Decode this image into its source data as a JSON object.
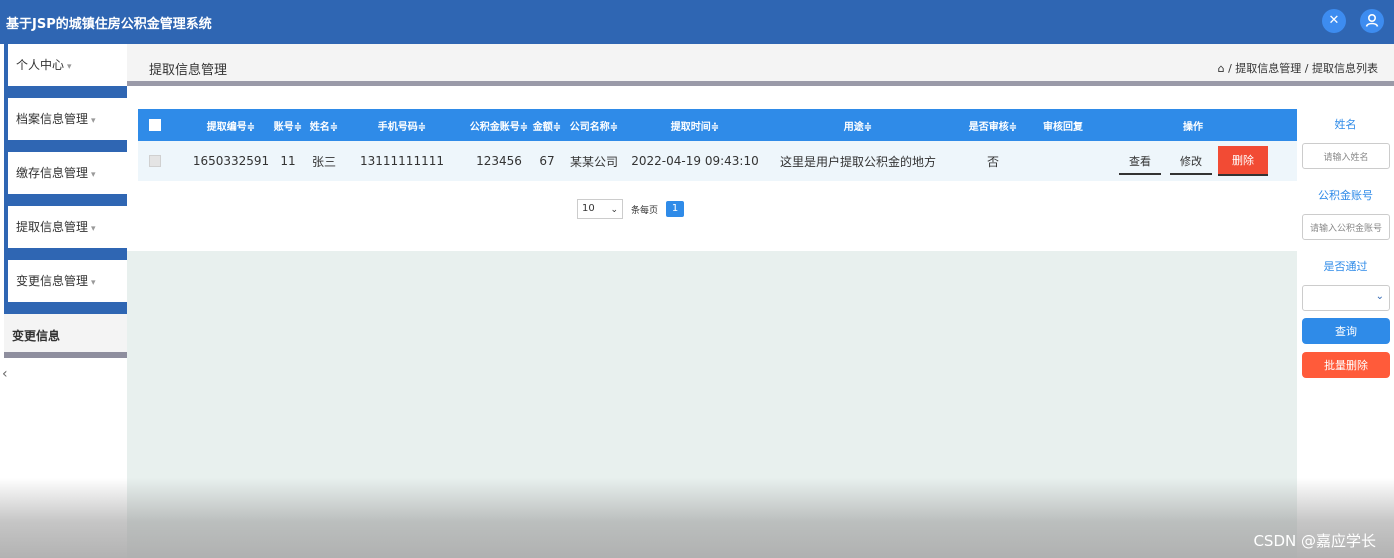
{
  "app": {
    "title": "基于JSP的城镇住房公积金管理系统"
  },
  "topbar_icons": [
    "expand-icon",
    "user-icon"
  ],
  "sidebar": {
    "items": [
      {
        "label": "个人中心",
        "caret": "▾"
      },
      {
        "label": "档案信息管理",
        "caret": "▾"
      },
      {
        "label": "缴存信息管理",
        "caret": "▾"
      },
      {
        "label": "提取信息管理",
        "caret": "▾"
      },
      {
        "label": "变更信息管理",
        "caret": "▾"
      }
    ],
    "submenu": {
      "label": "变更信息"
    }
  },
  "header": {
    "page_title": "提取信息管理",
    "breadcrumb": "/ 提取信息管理 / 提取信息列表"
  },
  "table": {
    "headers": [
      "提取编号≑",
      "账号≑",
      "姓名≑",
      "手机号码≑",
      "公积金账号≑",
      "金额≑",
      "公司名称≑",
      "提取时间≑",
      "用途≑",
      "是否审核≑",
      "审核回复",
      "操作"
    ],
    "rows": [
      {
        "cells": [
          "1650332591",
          "11",
          "张三",
          "13111111111",
          "123456",
          "67",
          "某某公司",
          "2022-04-19 09:43:10",
          "这里是用户提取公积金的地方",
          "否",
          ""
        ],
        "actions": {
          "view": "查看",
          "edit": "修改",
          "delete": "删除"
        }
      }
    ]
  },
  "pagination": {
    "page_size": "10",
    "page_size_label": "条每页",
    "current_page": "1"
  },
  "search": {
    "name_label": "姓名",
    "name_placeholder": "请输入姓名",
    "account_label": "公积金账号",
    "account_placeholder": "请输入公积金账号",
    "approved_label": "是否通过",
    "approved_value": "",
    "query_button": "查询",
    "batch_delete_button": "批量删除"
  },
  "colors": {
    "topbar": "#2f66b3",
    "table_header": "#2f8be8",
    "delete": "#f24b34",
    "batch_delete": "#ff5b3a"
  },
  "watermark": "CSDN @嘉应学长"
}
